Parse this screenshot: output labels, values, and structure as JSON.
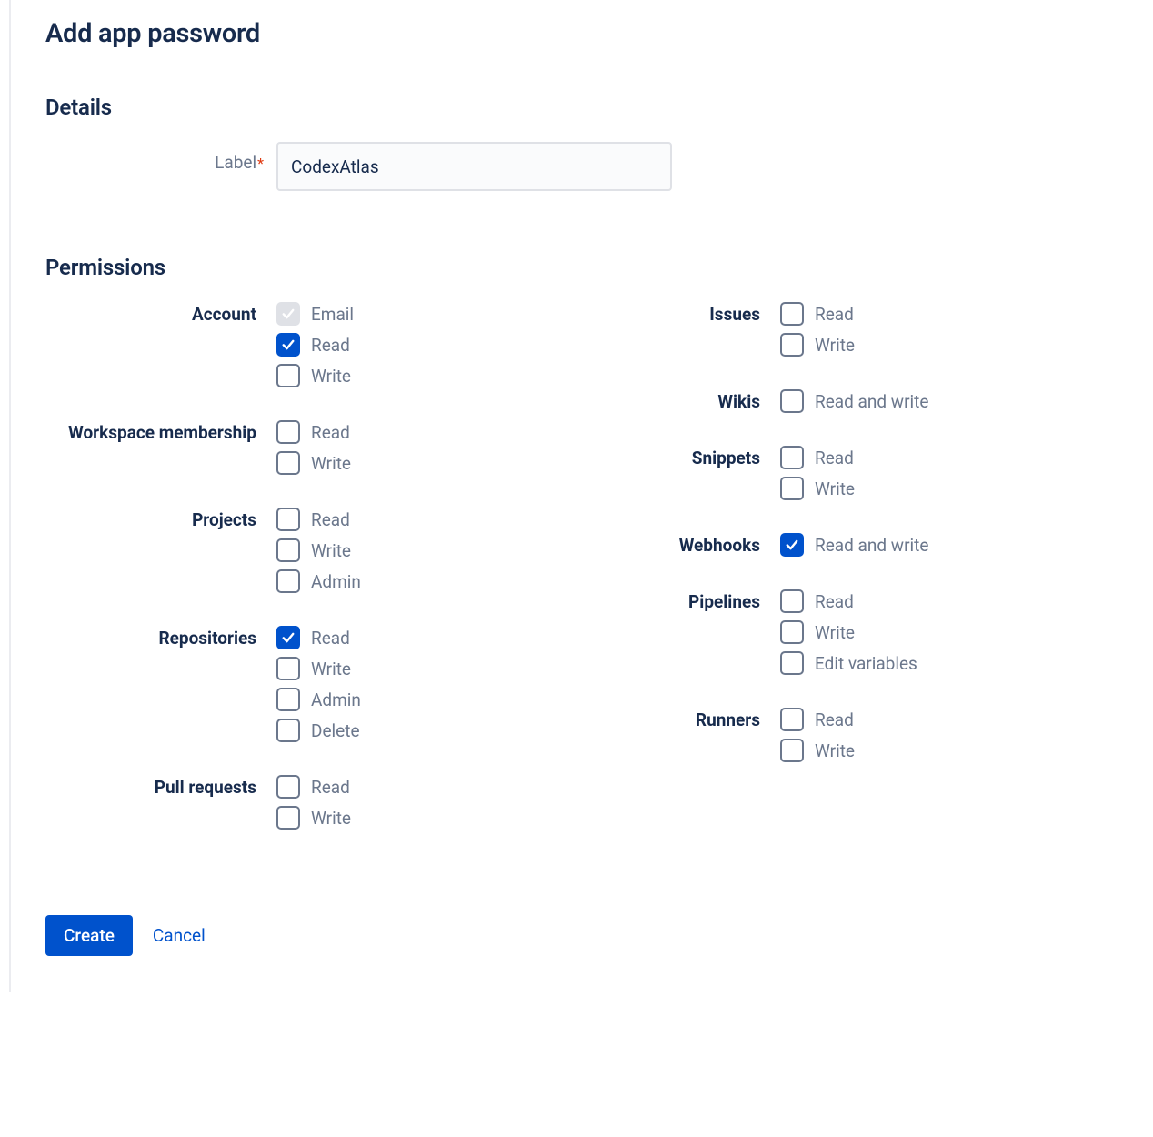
{
  "title": "Add app password",
  "details": {
    "heading": "Details",
    "label_field": {
      "label": "Label",
      "required": "*",
      "value": "CodexAtlas"
    }
  },
  "permissions": {
    "heading": "Permissions",
    "left": [
      {
        "name": "Account",
        "options": [
          {
            "label": "Email",
            "checked": true,
            "disabled": true
          },
          {
            "label": "Read",
            "checked": true,
            "disabled": false
          },
          {
            "label": "Write",
            "checked": false,
            "disabled": false
          }
        ]
      },
      {
        "name": "Workspace membership",
        "options": [
          {
            "label": "Read",
            "checked": false,
            "disabled": false
          },
          {
            "label": "Write",
            "checked": false,
            "disabled": false
          }
        ]
      },
      {
        "name": "Projects",
        "options": [
          {
            "label": "Read",
            "checked": false,
            "disabled": false
          },
          {
            "label": "Write",
            "checked": false,
            "disabled": false
          },
          {
            "label": "Admin",
            "checked": false,
            "disabled": false
          }
        ]
      },
      {
        "name": "Repositories",
        "options": [
          {
            "label": "Read",
            "checked": true,
            "disabled": false
          },
          {
            "label": "Write",
            "checked": false,
            "disabled": false
          },
          {
            "label": "Admin",
            "checked": false,
            "disabled": false
          },
          {
            "label": "Delete",
            "checked": false,
            "disabled": false
          }
        ]
      },
      {
        "name": "Pull requests",
        "options": [
          {
            "label": "Read",
            "checked": false,
            "disabled": false
          },
          {
            "label": "Write",
            "checked": false,
            "disabled": false
          }
        ]
      }
    ],
    "right": [
      {
        "name": "Issues",
        "options": [
          {
            "label": "Read",
            "checked": false,
            "disabled": false
          },
          {
            "label": "Write",
            "checked": false,
            "disabled": false
          }
        ]
      },
      {
        "name": "Wikis",
        "options": [
          {
            "label": "Read and write",
            "checked": false,
            "disabled": false
          }
        ]
      },
      {
        "name": "Snippets",
        "options": [
          {
            "label": "Read",
            "checked": false,
            "disabled": false
          },
          {
            "label": "Write",
            "checked": false,
            "disabled": false
          }
        ]
      },
      {
        "name": "Webhooks",
        "options": [
          {
            "label": "Read and write",
            "checked": true,
            "disabled": false
          }
        ]
      },
      {
        "name": "Pipelines",
        "options": [
          {
            "label": "Read",
            "checked": false,
            "disabled": false
          },
          {
            "label": "Write",
            "checked": false,
            "disabled": false
          },
          {
            "label": "Edit variables",
            "checked": false,
            "disabled": false
          }
        ]
      },
      {
        "name": "Runners",
        "options": [
          {
            "label": "Read",
            "checked": false,
            "disabled": false
          },
          {
            "label": "Write",
            "checked": false,
            "disabled": false
          }
        ]
      }
    ]
  },
  "actions": {
    "create": "Create",
    "cancel": "Cancel"
  }
}
